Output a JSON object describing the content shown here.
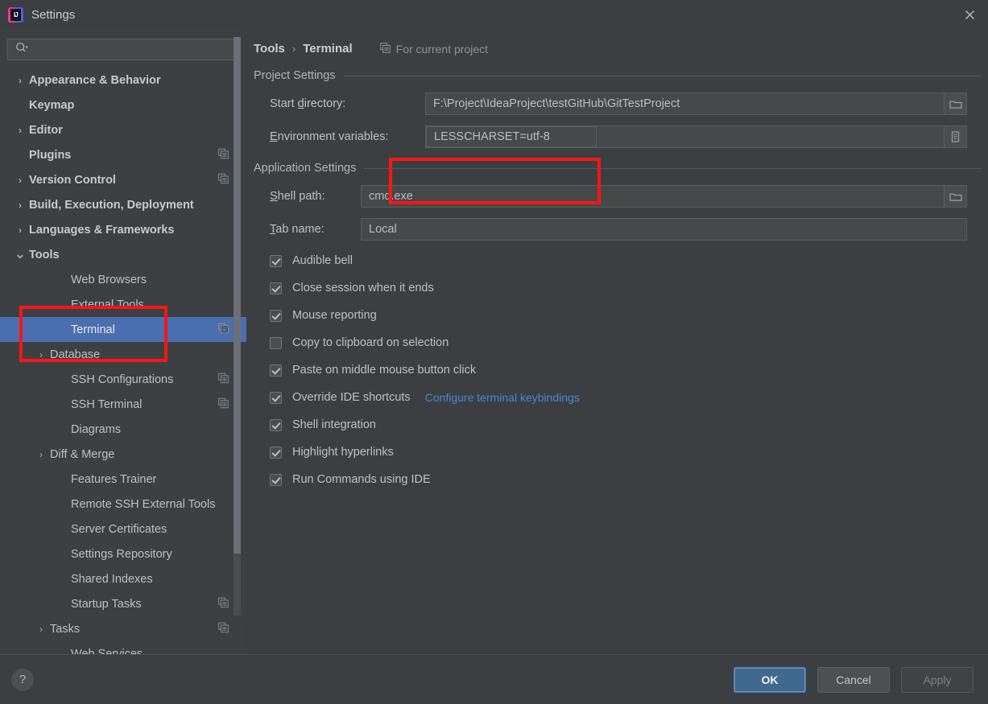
{
  "window": {
    "title": "Settings",
    "logo_icon": "intellij-idea-logo",
    "close_icon": "close-icon"
  },
  "sidebar": {
    "search": {
      "placeholder": "",
      "value": "",
      "icon": "search-icon",
      "dropdown_icon": "chevron-down-icon"
    },
    "items": [
      {
        "label": "Appearance & Behavior",
        "level": 1,
        "arrow": "right",
        "group": true,
        "copy": false,
        "selected": false
      },
      {
        "label": "Keymap",
        "level": 1,
        "arrow": "",
        "group": true,
        "copy": false,
        "selected": false
      },
      {
        "label": "Editor",
        "level": 1,
        "arrow": "right",
        "group": true,
        "copy": false,
        "selected": false
      },
      {
        "label": "Plugins",
        "level": 1,
        "arrow": "",
        "group": true,
        "copy": true,
        "selected": false
      },
      {
        "label": "Version Control",
        "level": 1,
        "arrow": "right",
        "group": true,
        "copy": true,
        "selected": false
      },
      {
        "label": "Build, Execution, Deployment",
        "level": 1,
        "arrow": "right",
        "group": true,
        "copy": false,
        "selected": false
      },
      {
        "label": "Languages & Frameworks",
        "level": 1,
        "arrow": "right",
        "group": true,
        "copy": false,
        "selected": false
      },
      {
        "label": "Tools",
        "level": 1,
        "arrow": "down",
        "group": true,
        "copy": false,
        "selected": false
      },
      {
        "label": "Web Browsers",
        "level": 2,
        "arrow": "",
        "group": false,
        "copy": false,
        "selected": false
      },
      {
        "label": "External Tools",
        "level": 2,
        "arrow": "",
        "group": false,
        "copy": false,
        "selected": false
      },
      {
        "label": "Terminal",
        "level": 2,
        "arrow": "",
        "group": false,
        "copy": true,
        "selected": true
      },
      {
        "label": "Database",
        "level": 2,
        "arrow": "right",
        "group": false,
        "copy": false,
        "selected": false
      },
      {
        "label": "SSH Configurations",
        "level": 2,
        "arrow": "",
        "group": false,
        "copy": true,
        "selected": false
      },
      {
        "label": "SSH Terminal",
        "level": 2,
        "arrow": "",
        "group": false,
        "copy": true,
        "selected": false
      },
      {
        "label": "Diagrams",
        "level": 2,
        "arrow": "",
        "group": false,
        "copy": false,
        "selected": false
      },
      {
        "label": "Diff & Merge",
        "level": 2,
        "arrow": "right",
        "group": false,
        "copy": false,
        "selected": false
      },
      {
        "label": "Features Trainer",
        "level": 2,
        "arrow": "",
        "group": false,
        "copy": false,
        "selected": false
      },
      {
        "label": "Remote SSH External Tools",
        "level": 2,
        "arrow": "",
        "group": false,
        "copy": false,
        "selected": false
      },
      {
        "label": "Server Certificates",
        "level": 2,
        "arrow": "",
        "group": false,
        "copy": false,
        "selected": false
      },
      {
        "label": "Settings Repository",
        "level": 2,
        "arrow": "",
        "group": false,
        "copy": false,
        "selected": false
      },
      {
        "label": "Shared Indexes",
        "level": 2,
        "arrow": "",
        "group": false,
        "copy": false,
        "selected": false
      },
      {
        "label": "Startup Tasks",
        "level": 2,
        "arrow": "",
        "group": false,
        "copy": true,
        "selected": false
      },
      {
        "label": "Tasks",
        "level": 2,
        "arrow": "right",
        "group": false,
        "copy": true,
        "selected": false
      },
      {
        "label": "Web Services",
        "level": 2,
        "arrow": "",
        "group": false,
        "copy": false,
        "selected": false
      }
    ]
  },
  "main": {
    "breadcrumb": {
      "root": "Tools",
      "separator": "›",
      "leaf": "Terminal"
    },
    "scope_hint": {
      "icon": "project-scope-icon",
      "text": "For current project"
    },
    "project_settings": {
      "title": "Project Settings",
      "start_directory": {
        "label_prefix": "Start ",
        "label_mnemonic": "d",
        "label_suffix": "irectory:",
        "value": "F:\\Project\\IdeaProject\\testGitHub\\GitTestProject",
        "browse_icon": "folder-icon"
      },
      "environment_variables": {
        "label_prefix": "",
        "label_mnemonic": "E",
        "label_suffix": "nvironment variables:",
        "value": "LESSCHARSET=utf-8",
        "browse_icon": "list-icon"
      }
    },
    "application_settings": {
      "title": "Application Settings",
      "shell_path": {
        "label_prefix": "",
        "label_mnemonic": "S",
        "label_suffix": "hell path:",
        "value": "cmd.exe",
        "browse_icon": "folder-icon"
      },
      "tab_name": {
        "label_prefix": "",
        "label_mnemonic": "T",
        "label_suffix": "ab name:",
        "value": "Local"
      },
      "checkboxes": [
        {
          "label": "Audible bell",
          "checked": true,
          "link": ""
        },
        {
          "label": "Close session when it ends",
          "checked": true,
          "link": ""
        },
        {
          "label": "Mouse reporting",
          "checked": true,
          "link": ""
        },
        {
          "label": "Copy to clipboard on selection",
          "checked": false,
          "link": ""
        },
        {
          "label": "Paste on middle mouse button click",
          "checked": true,
          "link": ""
        },
        {
          "label": "Override IDE shortcuts",
          "checked": true,
          "link": "Configure terminal keybindings"
        },
        {
          "label": "Shell integration",
          "checked": true,
          "link": ""
        },
        {
          "label": "Highlight hyperlinks",
          "checked": true,
          "link": ""
        },
        {
          "label": "Run Commands using IDE",
          "checked": true,
          "link": ""
        }
      ]
    }
  },
  "footer": {
    "help_label": "?",
    "ok_label": "OK",
    "cancel_label": "Cancel",
    "apply_label": "Apply"
  },
  "colors": {
    "accent_selection": "#4b6eaf",
    "annotation_red": "#ff1414",
    "link_blue": "#4a87cf",
    "panel_bg": "#3c3f41",
    "sidebar_bg": "#3c4043",
    "primary_button": "#41688f"
  }
}
